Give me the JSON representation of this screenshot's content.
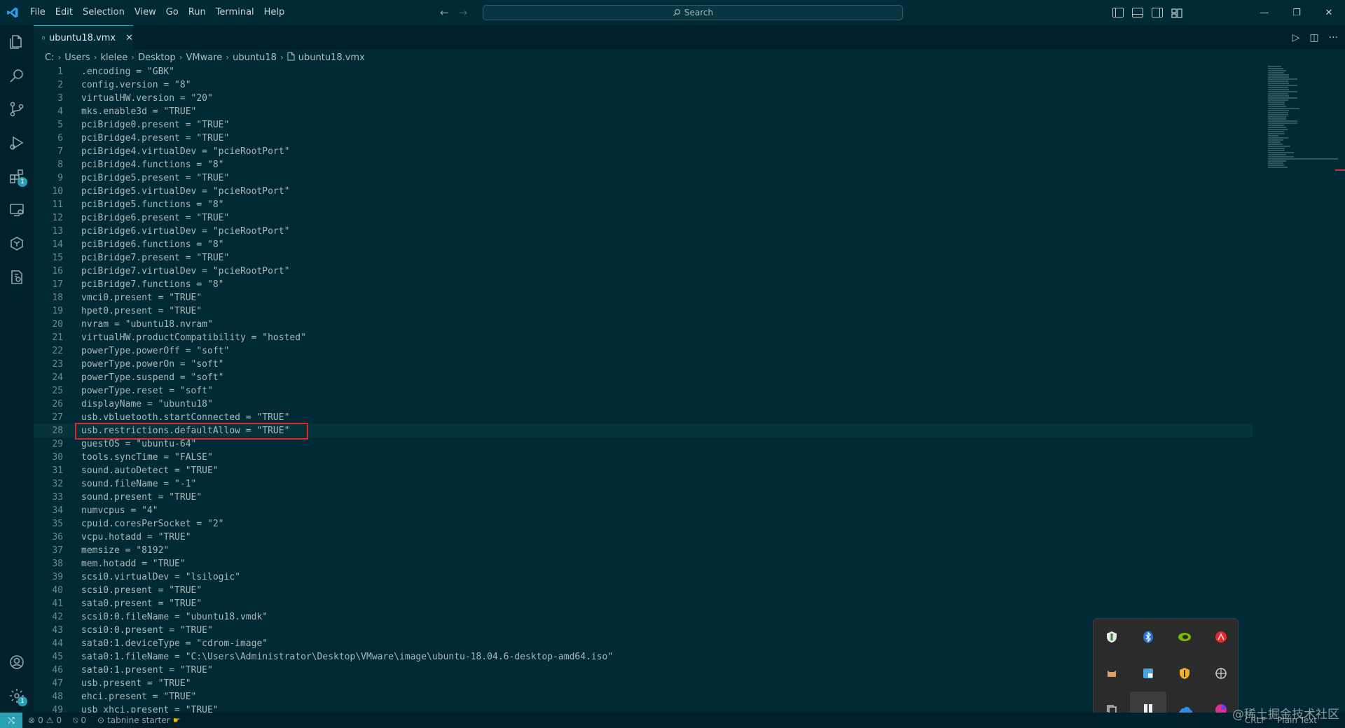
{
  "titlebar": {
    "menu": [
      "File",
      "Edit",
      "Selection",
      "View",
      "Go",
      "Run",
      "Terminal",
      "Help"
    ],
    "search_placeholder": "Search"
  },
  "activitybar": {
    "icons": [
      "explorer-icon",
      "search-icon",
      "source-control-icon",
      "run-debug-icon",
      "extensions-icon",
      "remote-explorer-icon",
      "docker-icon",
      "testing-icon"
    ],
    "extensions_badge": "1",
    "settings_badge": "1"
  },
  "tab": {
    "filename": "ubuntu18.vmx"
  },
  "breadcrumb": [
    "C:",
    "Users",
    "klelee",
    "Desktop",
    "VMware",
    "ubuntu18",
    "ubuntu18.vmx"
  ],
  "editor": {
    "highlighted_line": 28,
    "lines": [
      ".encoding = \"GBK\"",
      "config.version = \"8\"",
      "virtualHW.version = \"20\"",
      "mks.enable3d = \"TRUE\"",
      "pciBridge0.present = \"TRUE\"",
      "pciBridge4.present = \"TRUE\"",
      "pciBridge4.virtualDev = \"pcieRootPort\"",
      "pciBridge4.functions = \"8\"",
      "pciBridge5.present = \"TRUE\"",
      "pciBridge5.virtualDev = \"pcieRootPort\"",
      "pciBridge5.functions = \"8\"",
      "pciBridge6.present = \"TRUE\"",
      "pciBridge6.virtualDev = \"pcieRootPort\"",
      "pciBridge6.functions = \"8\"",
      "pciBridge7.present = \"TRUE\"",
      "pciBridge7.virtualDev = \"pcieRootPort\"",
      "pciBridge7.functions = \"8\"",
      "vmci0.present = \"TRUE\"",
      "hpet0.present = \"TRUE\"",
      "nvram = \"ubuntu18.nvram\"",
      "virtualHW.productCompatibility = \"hosted\"",
      "powerType.powerOff = \"soft\"",
      "powerType.powerOn = \"soft\"",
      "powerType.suspend = \"soft\"",
      "powerType.reset = \"soft\"",
      "displayName = \"ubuntu18\"",
      "usb.vbluetooth.startConnected = \"TRUE\"",
      "usb.restrictions.defaultAllow = \"TRUE\"",
      "guestOS = \"ubuntu-64\"",
      "tools.syncTime = \"FALSE\"",
      "sound.autoDetect = \"TRUE\"",
      "sound.fileName = \"-1\"",
      "sound.present = \"TRUE\"",
      "numvcpus = \"4\"",
      "cpuid.coresPerSocket = \"2\"",
      "vcpu.hotadd = \"TRUE\"",
      "memsize = \"8192\"",
      "mem.hotadd = \"TRUE\"",
      "scsi0.virtualDev = \"lsilogic\"",
      "scsi0.present = \"TRUE\"",
      "sata0.present = \"TRUE\"",
      "scsi0:0.fileName = \"ubuntu18.vmdk\"",
      "scsi0:0.present = \"TRUE\"",
      "sata0:1.deviceType = \"cdrom-image\"",
      "sata0:1.fileName = \"C:\\Users\\Administrator\\Desktop\\VMware\\image\\ubuntu-18.04.6-desktop-amd64.iso\"",
      "sata0:1.present = \"TRUE\"",
      "usb.present = \"TRUE\"",
      "ehci.present = \"TRUE\"",
      "usb_xhci.present = \"TRUE\""
    ]
  },
  "statusbar": {
    "errors": "0",
    "warnings": "0",
    "ports": "0",
    "tabnine": "tabnine starter",
    "line_ending": "CRLF",
    "language": "Plain Text"
  },
  "tray": {
    "icons": [
      "defender-shield-icon",
      "bluetooth-icon",
      "nvidia-icon",
      "adobe-icon",
      "cat-app-icon",
      "windows-app-icon",
      "security-shield-icon",
      "network-app-icon",
      "copy-app-icon",
      "bookmark-app-icon",
      "onedrive-icon",
      "colorful-app-icon"
    ]
  },
  "watermark": "@稀土掘金技术社区",
  "colors": {
    "accent": "#2aa1b3",
    "highlight_box": "#e0262b",
    "editor_bg": "#002b36"
  }
}
